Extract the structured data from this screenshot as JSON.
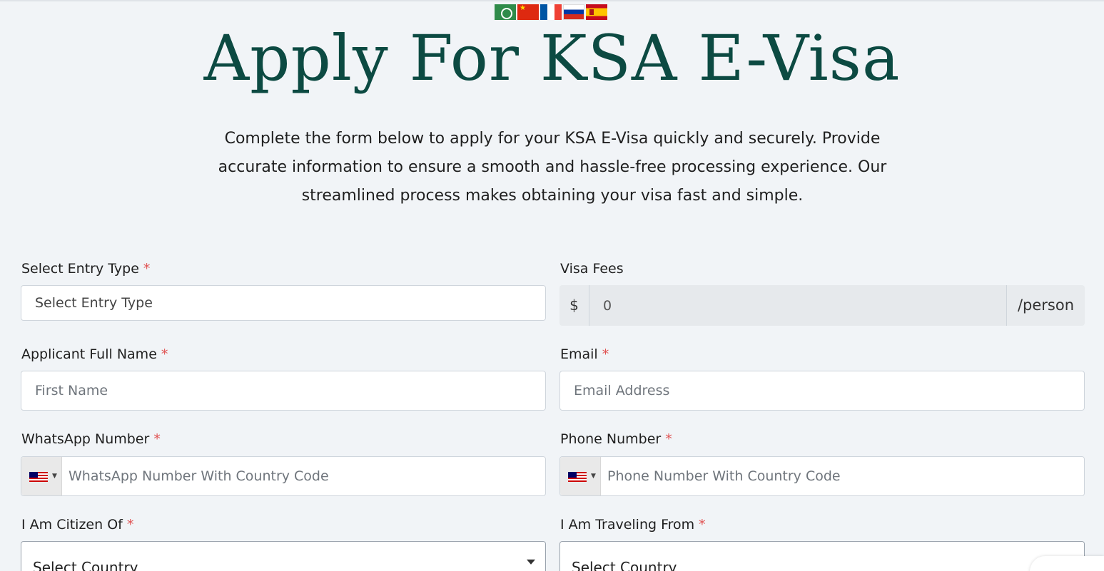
{
  "title": "Apply For KSA E-Visa",
  "intro": "Complete the form below to apply for your KSA E-Visa quickly and securely. Provide accurate information to ensure a smooth and hassle-free processing experience. Our streamlined process makes obtaining your visa fast and simple.",
  "languages": [
    "arabic",
    "chinese",
    "french",
    "russian",
    "spanish"
  ],
  "required_mark": "*",
  "form": {
    "entry_type": {
      "label": "Select Entry Type",
      "placeholder": "Select Entry Type"
    },
    "visa_fees": {
      "label": "Visa Fees",
      "currency": "$",
      "value": "0",
      "unit": "/person"
    },
    "full_name": {
      "label": "Applicant Full Name",
      "placeholder": "First Name"
    },
    "email": {
      "label": "Email",
      "placeholder": "Email Address"
    },
    "whatsapp": {
      "label": "WhatsApp Number",
      "placeholder": "WhatsApp Number With Country Code"
    },
    "phone": {
      "label": "Phone Number",
      "placeholder": "Phone Number With Country Code"
    },
    "citizen_of": {
      "label": "I Am Citizen Of",
      "placeholder": "Select Country"
    },
    "traveling_from": {
      "label": "I Am Traveling From",
      "placeholder": "Select Country"
    }
  },
  "colors": {
    "title": "#0c4a42",
    "required": "#e05252",
    "background": "#f1f4f7"
  }
}
